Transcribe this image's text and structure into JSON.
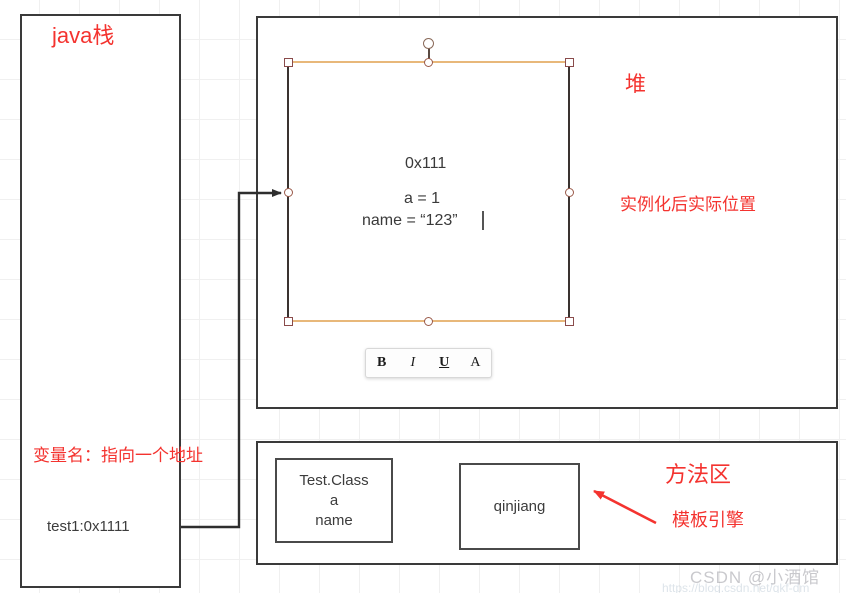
{
  "diagram": {
    "java_stack": {
      "title": "java栈",
      "var_note": "变量名：指向一个地址",
      "entry": "test1:0x1111"
    },
    "heap": {
      "title": "堆",
      "note": "实例化后实际位置",
      "object": {
        "address": "0x111",
        "field_a": "a = 1",
        "field_name": "name =  “123”"
      },
      "toolbar": {
        "bold_label": "B",
        "italic_label": "I",
        "underline_label": "U",
        "font_label": "A"
      }
    },
    "method_area": {
      "title": "方法区",
      "note": "模板引擎",
      "class_box": {
        "line1": "Test.Class",
        "line2": "a",
        "line3": "name"
      },
      "string_box": {
        "text": "qinjiang"
      }
    },
    "watermark": {
      "text": "CSDN @小酒馆",
      "url": "https://blog.csdn.net/qkf-dm"
    },
    "colors": {
      "annotation_red": "#f4332f",
      "box_border": "#3a3a3a",
      "selection_orange": "#e8b87a",
      "handle_border": "#8a4b4b"
    }
  }
}
